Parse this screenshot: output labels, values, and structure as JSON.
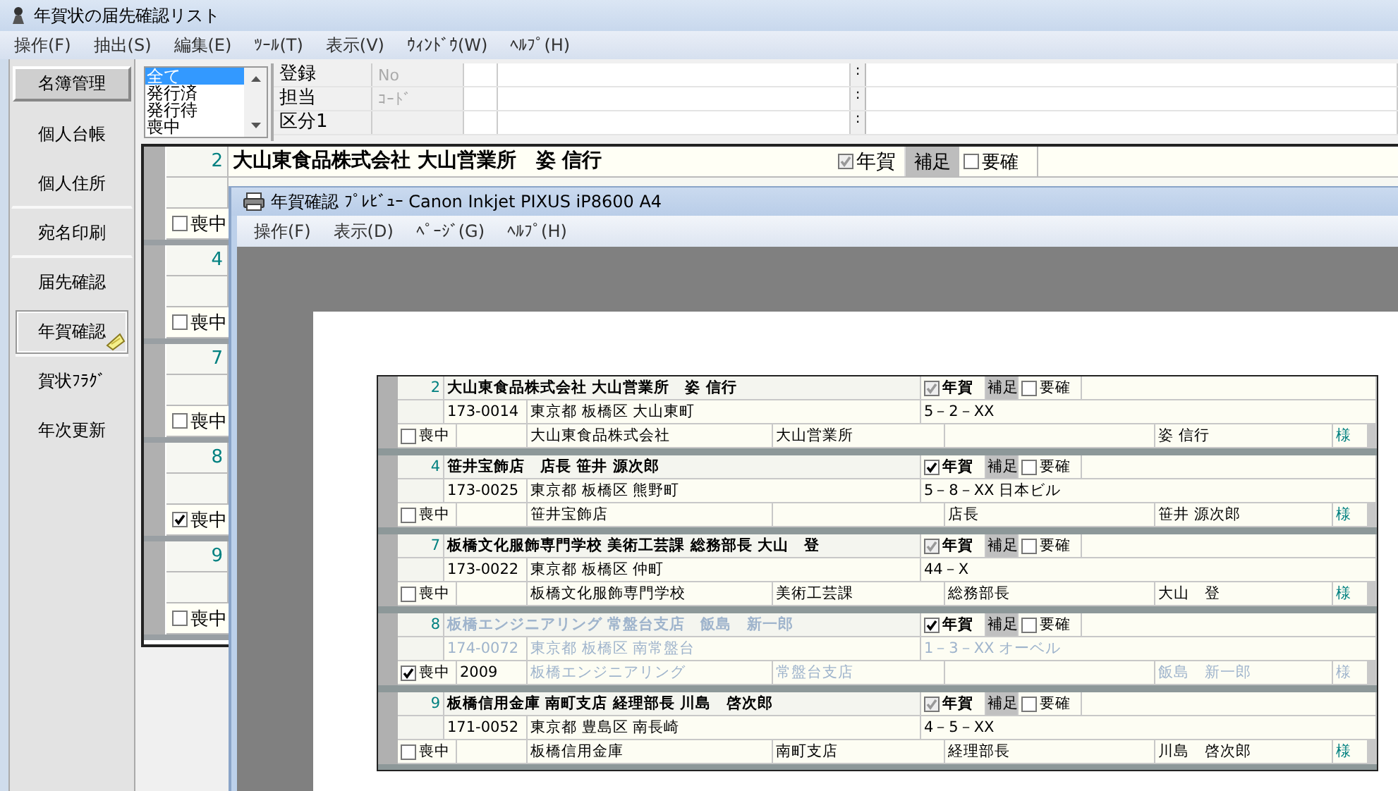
{
  "window": {
    "title": "年賀状の届先確認リスト"
  },
  "menu": [
    "操作(F)",
    "抽出(S)",
    "編集(E)",
    "ﾂｰﾙ(T)",
    "表示(V)",
    "ｳｨﾝﾄﾞｳ(W)",
    "ﾍﾙﾌﾟ(H)"
  ],
  "sidebar": {
    "items": [
      {
        "label": "名簿管理",
        "selected": true,
        "focused": false,
        "divider_after": false
      },
      {
        "label": "個人台帳",
        "selected": false,
        "focused": false,
        "divider_after": false
      },
      {
        "label": "個人住所",
        "selected": false,
        "focused": false,
        "divider_after": true
      },
      {
        "label": "宛名印刷",
        "selected": false,
        "focused": false,
        "divider_after": true
      },
      {
        "label": "届先確認",
        "selected": false,
        "focused": false,
        "divider_after": false
      },
      {
        "label": "年賀確認",
        "selected": false,
        "focused": true,
        "divider_after": true
      },
      {
        "label": "賀状ﾌﾗｸﾞ",
        "selected": false,
        "focused": false,
        "divider_after": false
      },
      {
        "label": "年次更新",
        "selected": false,
        "focused": false,
        "divider_after": false
      }
    ]
  },
  "filter": {
    "status_list": [
      {
        "label": "全て",
        "selected": true
      },
      {
        "label": "発行済",
        "selected": false
      },
      {
        "label": "発行待",
        "selected": false
      },
      {
        "label": "喪中",
        "selected": false
      }
    ],
    "fields": [
      {
        "label": "登録",
        "placeholder": "No",
        "separator": ":"
      },
      {
        "label": "担当",
        "placeholder": "ｺｰﾄﾞ",
        "separator": ":"
      },
      {
        "label": "区分1",
        "separator": ":"
      }
    ]
  },
  "records": [
    {
      "number": "2",
      "name": "大山東食品株式会社 大山営業所　姿 信行",
      "nenga": {
        "label": "年賀",
        "checked": true,
        "disabled": true
      },
      "supplement": "補足",
      "confirm": {
        "label": "要確",
        "checked": false
      },
      "mourning": {
        "label": "喪中",
        "checked": false
      }
    },
    {
      "number": "4",
      "mourning": {
        "label": "喪中",
        "checked": false
      }
    },
    {
      "number": "7",
      "mourning": {
        "label": "喪中",
        "checked": false
      }
    },
    {
      "number": "8",
      "mourning": {
        "label": "喪中",
        "checked": true
      }
    },
    {
      "number": "9",
      "mourning": {
        "label": "喪中",
        "checked": false
      }
    }
  ],
  "preview": {
    "title": "年賀確認 ﾌﾟﾚﾋﾞｭｰ Canon Inkjet PIXUS iP8600  A4",
    "menu": [
      "操作(F)",
      "表示(D)",
      "ﾍﾟｰｼﾞ(G)",
      "ﾍﾙﾌﾟ(H)"
    ],
    "records": [
      {
        "number": "2",
        "dimmed": false,
        "name": "大山東食品株式会社 大山営業所　姿 信行",
        "nenga": {
          "label": "年賀",
          "checked": true,
          "disabled": true
        },
        "supplement": "補足",
        "confirm": {
          "label": "要確",
          "checked": false
        },
        "zip": "173-0014",
        "address": "東京都 板橋区 大山東町",
        "address2": "5－2－XX",
        "mourning": {
          "label": "喪中",
          "checked": false
        },
        "company": "大山東食品株式会社",
        "department": "大山営業所",
        "person": "姿 信行",
        "honorific": "様"
      },
      {
        "number": "4",
        "dimmed": false,
        "name": "笹井宝飾店　店長 笹井 源次郎",
        "nenga": {
          "label": "年賀",
          "checked": true,
          "disabled": false
        },
        "supplement": "補足",
        "confirm": {
          "label": "要確",
          "checked": false
        },
        "zip": "173-0025",
        "address": "東京都 板橋区 熊野町",
        "address2": "5－8－XX 日本ビル",
        "mourning": {
          "label": "喪中",
          "checked": false
        },
        "company": "笹井宝飾店",
        "position": "店長",
        "person": "笹井 源次郎",
        "honorific": "様"
      },
      {
        "number": "7",
        "dimmed": false,
        "name": "板橋文化服飾専門学校 美術工芸課 総務部長 大山　登",
        "nenga": {
          "label": "年賀",
          "checked": true,
          "disabled": true
        },
        "supplement": "補足",
        "confirm": {
          "label": "要確",
          "checked": false
        },
        "zip": "173-0022",
        "address": "東京都 板橋区 仲町",
        "address2": "44－X",
        "mourning": {
          "label": "喪中",
          "checked": false
        },
        "company": "板橋文化服飾専門学校",
        "department": "美術工芸課",
        "position": "総務部長",
        "person": "大山　登",
        "honorific": "様"
      },
      {
        "number": "8",
        "dimmed": true,
        "name": "板橋エンジニアリング 常盤台支店　飯島　新一郎",
        "nenga": {
          "label": "年賀",
          "checked": true,
          "disabled": false
        },
        "supplement": "補足",
        "confirm": {
          "label": "要確",
          "checked": false
        },
        "zip": "174-0072",
        "address": "東京都 板橋区 南常盤台",
        "address2": "1－3－XX オーベル",
        "mourning": {
          "label": "喪中",
          "checked": true
        },
        "code": "2009",
        "company": "板橋エンジニアリング",
        "department": "常盤台支店",
        "person": "飯島　新一郎",
        "honorific": "様"
      },
      {
        "number": "9",
        "dimmed": false,
        "name": "板橋信用金庫 南町支店 経理部長 川島　啓次郎",
        "nenga": {
          "label": "年賀",
          "checked": true,
          "disabled": true
        },
        "supplement": "補足",
        "confirm": {
          "label": "要確",
          "checked": false
        },
        "zip": "171-0052",
        "address": "東京都 豊島区 南長崎",
        "address2": "4－5－XX",
        "mourning": {
          "label": "喪中",
          "checked": false
        },
        "company": "板橋信用金庫",
        "department": "南町支店",
        "position": "経理部長",
        "person": "川島　啓次郎",
        "honorific": "様"
      }
    ]
  }
}
